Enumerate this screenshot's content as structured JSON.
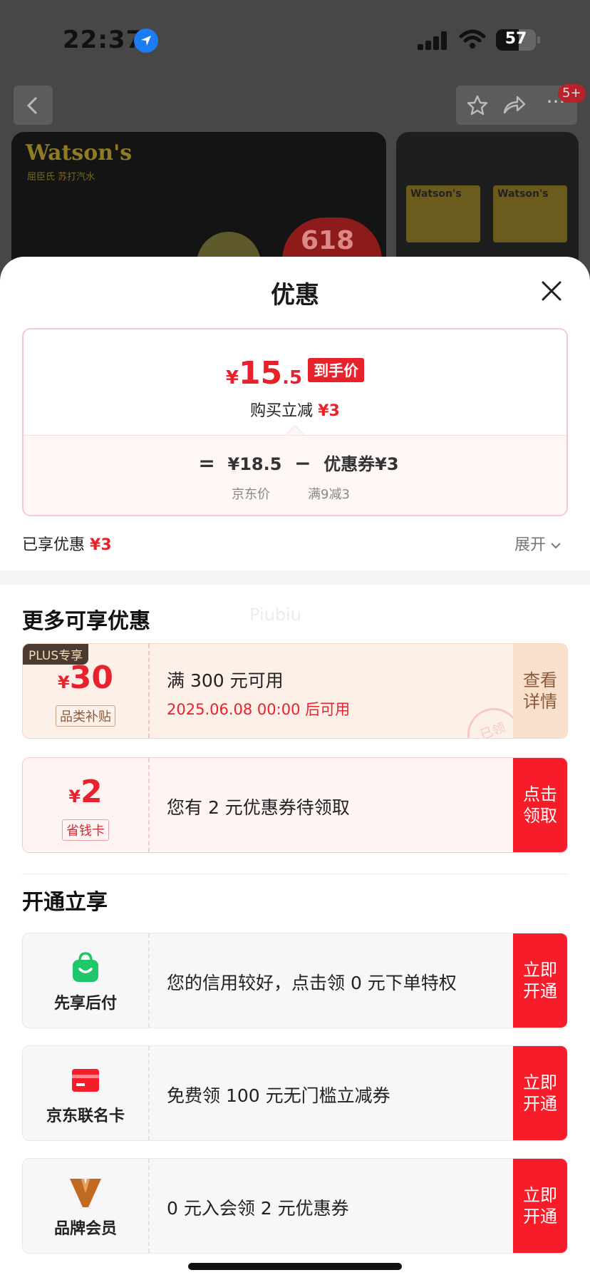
{
  "status_bar": {
    "time": "22:37",
    "battery": "57",
    "battery_level": 0.57
  },
  "header": {
    "badge": "5+"
  },
  "product_images": {
    "brand": "Watson's",
    "brand_sub": "屈臣氏 苏打汽水",
    "event": "618",
    "can_brand": "Watson's"
  },
  "sheet": {
    "title": "优惠"
  },
  "price_card": {
    "currency": "¥",
    "price_int": "15",
    "price_dec": ".5",
    "price_tag": "到手价",
    "instant_label": "购买立减",
    "instant_value": "¥3",
    "eq": "=",
    "jd_price": "¥18.5",
    "minus": "−",
    "coupon_part": "优惠券¥3",
    "jd_price_label": "京东价",
    "coupon_rule": "满9减3"
  },
  "enjoyed": {
    "label": "已享优惠",
    "value": "¥3",
    "expand": "展开"
  },
  "more": {
    "title": "更多可享优惠",
    "watermark": "Piubiu",
    "plus_coupon": {
      "tag": "PLUS专享",
      "currency": "¥",
      "amount": "30",
      "type": "品类补贴",
      "title": "满 300 元可用",
      "subtitle": "2025.06.08 00:00 后可用",
      "action": [
        "查看",
        "详情"
      ],
      "stamp": "已领"
    },
    "save_coupon": {
      "currency": "¥",
      "amount": "2",
      "type": "省钱卡",
      "title": "您有 2 元优惠券待领取",
      "action": [
        "点击",
        "领取"
      ]
    }
  },
  "open": {
    "title": "开通立享",
    "items": [
      {
        "label": "先享后付",
        "text": "您的信用较好，点击领 0 元下单特权",
        "action": [
          "立即",
          "开通"
        ],
        "icon": "shopping-bag-icon"
      },
      {
        "label": "京东联名卡",
        "text": "免费领 100 元无门槛立减券",
        "action": [
          "立即",
          "开通"
        ],
        "icon": "credit-card-icon"
      },
      {
        "label": "品牌会员",
        "text": "0 元入会领 2 元优惠券",
        "action": [
          "立即",
          "开通"
        ],
        "icon": "brand-v-icon"
      }
    ]
  },
  "colors": {
    "accent": "#e8222c",
    "action_red": "#f61c2a",
    "plus_bg": "#fdf0e8"
  }
}
